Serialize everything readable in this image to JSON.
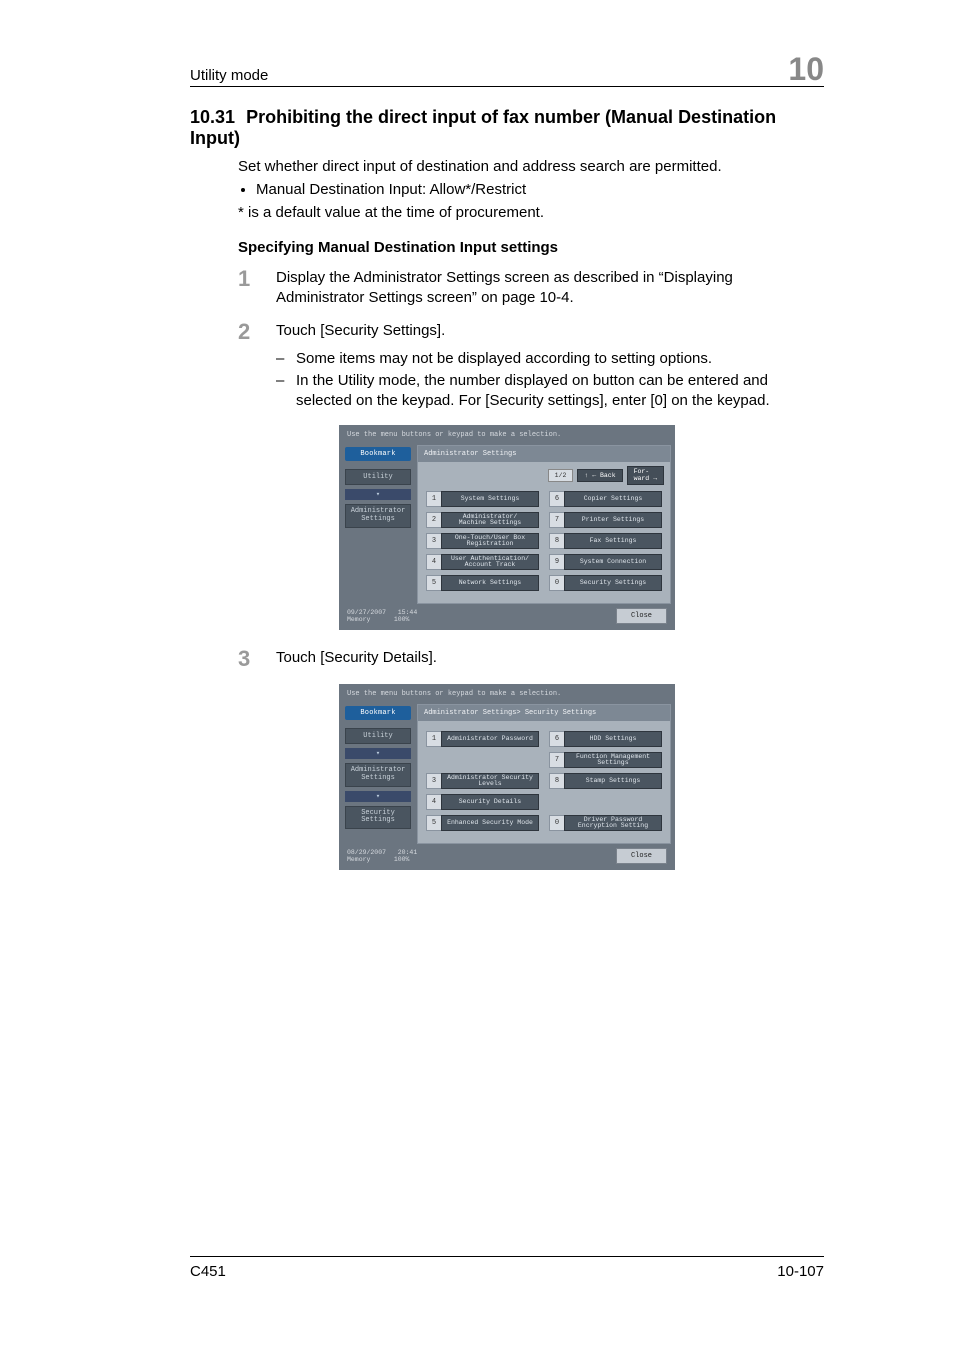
{
  "header": {
    "left": "Utility mode",
    "chapter": "10"
  },
  "h1": {
    "num": "10.31",
    "title": "Prohibiting the direct input of fax number (Manual Destination Input)"
  },
  "intro": "Set whether direct input of destination and address search are permitted.",
  "bullet1": "Manual Destination Input: Allow*/Restrict",
  "defnote": "* is a default value at the time of procurement.",
  "h2": "Specifying Manual Destination Input settings",
  "steps": {
    "s1": {
      "num": "1",
      "text": "Display the Administrator Settings screen as described in “Displaying Administrator Settings screen” on page 10-4."
    },
    "s2": {
      "num": "2",
      "text": "Touch [Security Settings]."
    },
    "s2sub": {
      "a": "Some items may not be displayed according to setting options.",
      "b": "In the Utility mode, the number displayed on button can be entered and selected on the keypad. For [Security settings], enter [0] on the keypad."
    },
    "s3": {
      "num": "3",
      "text": "Touch [Security Details]."
    }
  },
  "dash": "–",
  "screenshot1": {
    "topline": "Use the menu buttons or keypad to make a selection.",
    "bookmark": "Bookmark",
    "nav": {
      "utility": "Utility",
      "admin": "Administrator\nSettings"
    },
    "crumb": "Administrator Settings",
    "paging": "1/2",
    "back": "← Back",
    "fwd": "For-\nward →",
    "left": [
      {
        "n": "1",
        "label": "System Settings"
      },
      {
        "n": "2",
        "label": "Administrator/\nMachine Settings"
      },
      {
        "n": "3",
        "label": "One-Touch/User Box\nRegistration"
      },
      {
        "n": "4",
        "label": "User Authentication/\nAccount Track"
      },
      {
        "n": "5",
        "label": "Network Settings"
      }
    ],
    "right": [
      {
        "n": "6",
        "label": "Copier Settings"
      },
      {
        "n": "7",
        "label": "Printer Settings"
      },
      {
        "n": "8",
        "label": "Fax Settings"
      },
      {
        "n": "9",
        "label": "System Connection"
      },
      {
        "n": "0",
        "label": "Security Settings"
      }
    ],
    "footer": {
      "date": "09/27/2007",
      "time": "15:44",
      "memlabel": "Memory",
      "mem": "100%",
      "close": "Close"
    }
  },
  "screenshot2": {
    "topline": "Use the menu buttons or keypad to make a selection.",
    "bookmark": "Bookmark",
    "nav": {
      "utility": "Utility",
      "admin": "Administrator\nSettings",
      "security": "Security\nSettings"
    },
    "crumb": "Administrator Settings> Security Settings",
    "left": [
      {
        "n": "1",
        "label": "Administrator Password"
      },
      null,
      {
        "n": "3",
        "label": "Administrator Security\nLevels"
      },
      {
        "n": "4",
        "label": "Security Details"
      },
      {
        "n": "5",
        "label": "Enhanced Security Mode"
      }
    ],
    "right": [
      {
        "n": "6",
        "label": "HDD Settings"
      },
      {
        "n": "7",
        "label": "Function Management Settings"
      },
      {
        "n": "8",
        "label": "Stamp Settings"
      },
      null,
      {
        "n": "0",
        "label": "Driver Password\nEncryption Setting"
      }
    ],
    "footer": {
      "date": "08/29/2007",
      "time": "20:41",
      "memlabel": "Memory",
      "mem": "100%",
      "close": "Close"
    }
  },
  "pagefoot": {
    "model": "C451",
    "page": "10-107"
  }
}
